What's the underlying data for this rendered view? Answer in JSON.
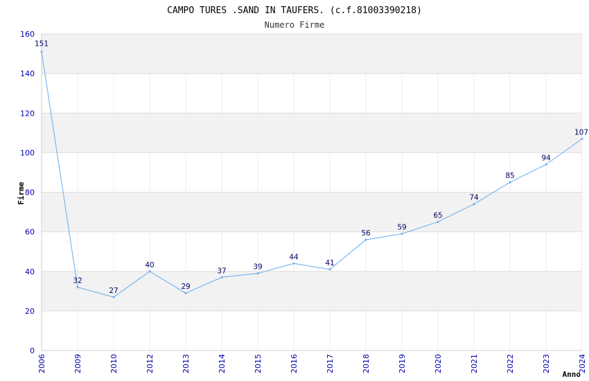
{
  "chart_data": {
    "type": "line",
    "title": "CAMPO TURES .SAND IN TAUFERS. (c.f.81003390218)",
    "subtitle": "Numero Firme",
    "xlabel": "Anno",
    "ylabel": "Firme",
    "ylim": [
      0,
      160
    ],
    "yticks": [
      0,
      20,
      40,
      60,
      80,
      100,
      120,
      140,
      160
    ],
    "categories": [
      "2006",
      "2009",
      "2010",
      "2012",
      "2013",
      "2014",
      "2015",
      "2016",
      "2017",
      "2018",
      "2019",
      "2020",
      "2021",
      "2022",
      "2023",
      "2024"
    ],
    "values": [
      151,
      32,
      27,
      40,
      29,
      37,
      39,
      44,
      41,
      56,
      59,
      65,
      74,
      85,
      94,
      107
    ],
    "grid": true,
    "legend": "none",
    "colors": {
      "line": "#66aaee",
      "band": "#f2f2f2",
      "tick_text": "#0000aa",
      "label_text": "#000066"
    }
  }
}
